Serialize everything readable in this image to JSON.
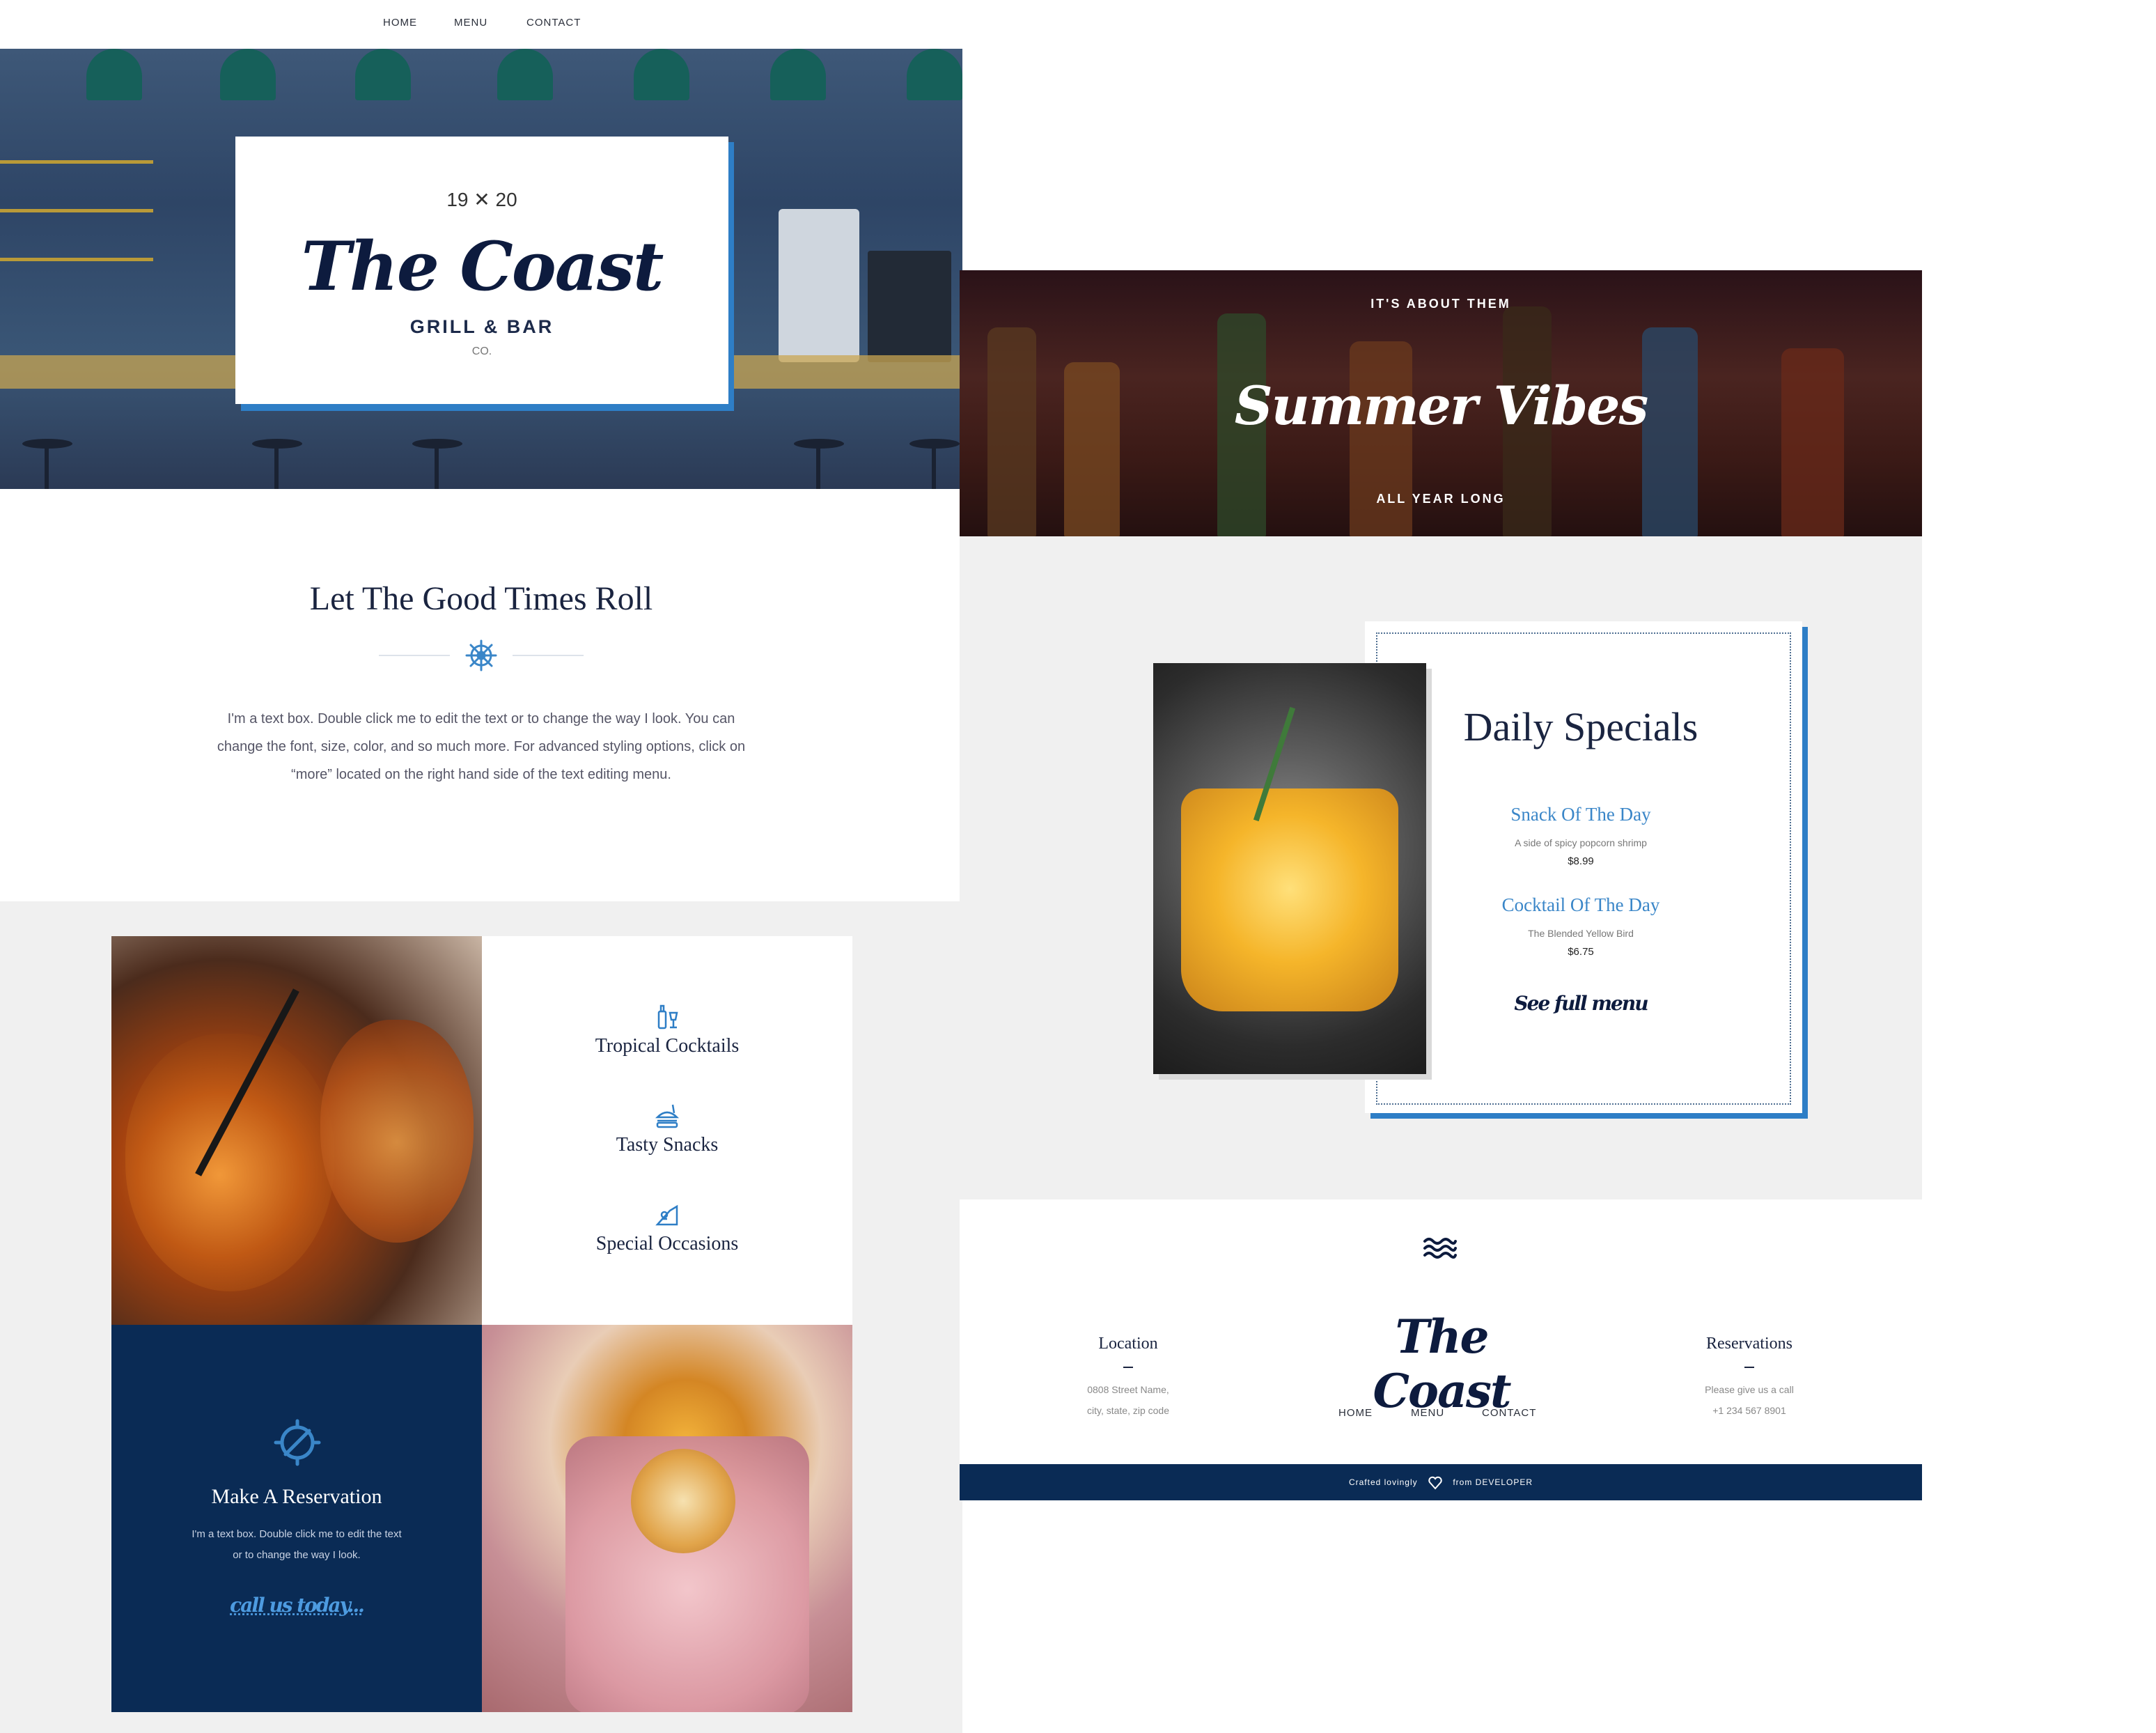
{
  "nav": {
    "home": "HOME",
    "menu": "MENU",
    "contact": "CONTACT"
  },
  "hero": {
    "year": "19 ✕ 20",
    "title": "The Coast",
    "subtitle": "GRILL & BAR",
    "co": "CO."
  },
  "intro": {
    "title": "Let The Good Times Roll",
    "text": "I'm a text box. Double click me to edit the text or to change the way I look. You can change the font, size, color, and so much more. For advanced styling options, click on “more” located on the right hand side of the text editing menu."
  },
  "features": [
    {
      "label": "Tropical Cocktails",
      "icon": "bottle-glass-icon"
    },
    {
      "label": "Tasty Snacks",
      "icon": "burger-drink-icon"
    },
    {
      "label": "Special Occasions",
      "icon": "celebration-icon"
    }
  ],
  "reservation": {
    "title": "Make A Reservation",
    "text": "I'm a text box. Double click me to edit the text or to change the way I look.",
    "link": "call us today..."
  },
  "summer": {
    "top": "IT'S ABOUT THEM",
    "title": "Summer Vibes",
    "bottom": "ALL YEAR LONG"
  },
  "specials": {
    "title": "Daily Specials",
    "items": [
      {
        "name": "Snack Of The Day",
        "desc": "A side of spicy popcorn shrimp",
        "price": "$8.99"
      },
      {
        "name": "Cocktail Of The Day",
        "desc": "The Blended Yellow Bird",
        "price": "$6.75"
      }
    ],
    "menu_link": "See full menu"
  },
  "footer": {
    "location": {
      "title": "Location",
      "line1": "0808 Street Name,",
      "line2": "city, state, zip code"
    },
    "logo": "The Coast",
    "nav": {
      "home": "HOME",
      "menu": "MENU",
      "contact": "CONTACT"
    },
    "reservations": {
      "title": "Reservations",
      "line1": "Please give us a call",
      "line2": "+1 234 567 8901"
    },
    "credit": {
      "prefix": "Crafted lovingly",
      "suffix": "from DEVELOPER"
    }
  },
  "colors": {
    "navy": "#0a2b55",
    "accent": "#2e7ec6",
    "link": "#3a86c8",
    "panel": "#f0f0f0"
  }
}
